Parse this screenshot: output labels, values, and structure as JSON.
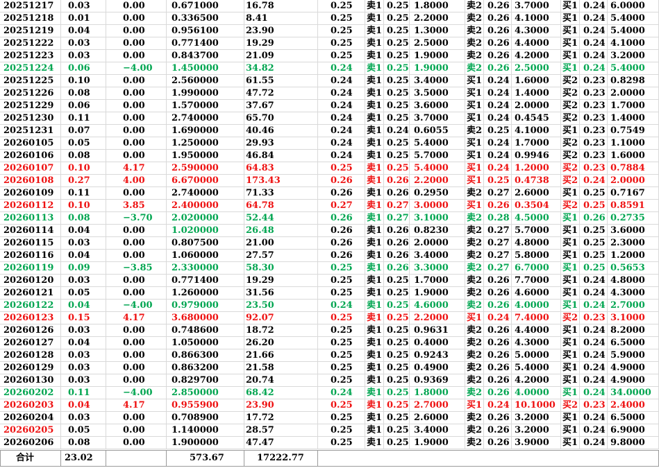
{
  "colors": {
    "normal": "#000000",
    "up": "#ee1111",
    "down": "#00a550"
  },
  "rows": [
    {
      "c": "blk",
      "date": "20251217",
      "rate": "0.03",
      "chg": "0.00",
      "vol": "0.671000",
      "amt": "16.78",
      "price": "0.25",
      "s1": "卖1",
      "s1p": "0.25",
      "s1v": "1.8000",
      "s2": "卖2",
      "s2p": "0.26",
      "s2v": "3.7000",
      "b1": "买1",
      "b1p": "0.24",
      "b1v": "6.0000"
    },
    {
      "c": "blk",
      "date": "20251218",
      "rate": "0.01",
      "chg": "0.00",
      "vol": "0.336500",
      "amt": "8.41",
      "price": "0.25",
      "s1": "卖1",
      "s1p": "0.25",
      "s1v": "2.2000",
      "s2": "卖2",
      "s2p": "0.26",
      "s2v": "4.1000",
      "b1": "买1",
      "b1p": "0.24",
      "b1v": "5.4000"
    },
    {
      "c": "blk",
      "date": "20251219",
      "rate": "0.04",
      "chg": "0.00",
      "vol": "0.956100",
      "amt": "23.90",
      "price": "0.25",
      "s1": "卖1",
      "s1p": "0.25",
      "s1v": "1.3000",
      "s2": "卖2",
      "s2p": "0.26",
      "s2v": "4.3000",
      "b1": "买1",
      "b1p": "0.24",
      "b1v": "5.4000"
    },
    {
      "c": "blk",
      "date": "20251222",
      "rate": "0.03",
      "chg": "0.00",
      "vol": "0.771400",
      "amt": "19.29",
      "price": "0.25",
      "s1": "卖1",
      "s1p": "0.25",
      "s1v": "2.5000",
      "s2": "卖2",
      "s2p": "0.26",
      "s2v": "4.4000",
      "b1": "买1",
      "b1p": "0.24",
      "b1v": "4.1000"
    },
    {
      "c": "blk",
      "date": "20251223",
      "rate": "0.03",
      "chg": "0.00",
      "vol": "0.843700",
      "amt": "21.09",
      "price": "0.25",
      "s1": "卖1",
      "s1p": "0.25",
      "s1v": "1.9000",
      "s2": "卖2",
      "s2p": "0.26",
      "s2v": "4.2000",
      "b1": "买1",
      "b1p": "0.24",
      "b1v": "3.2000"
    },
    {
      "c": "grn",
      "date": "20251224",
      "rate": "0.06",
      "chg": "−4.00",
      "vol": "1.450000",
      "amt": "34.82",
      "price": "0.24",
      "s1": "卖1",
      "s1p": "0.25",
      "s1v": "1.9000",
      "s2": "卖2",
      "s2p": "0.26",
      "s2v": "2.5000",
      "b1": "买1",
      "b1p": "0.24",
      "b1v": "5.4000"
    },
    {
      "c": "blk",
      "date": "20251225",
      "rate": "0.10",
      "chg": "0.00",
      "vol": "2.560000",
      "amt": "61.55",
      "price": "0.24",
      "s1": "卖1",
      "s1p": "0.25",
      "s1v": "3.4000",
      "s2": "买1",
      "s2p": "0.24",
      "s2v": "1.6000",
      "b1": "买2",
      "b1p": "0.23",
      "b1v": "0.8298"
    },
    {
      "c": "blk",
      "date": "20251226",
      "rate": "0.08",
      "chg": "0.00",
      "vol": "1.990000",
      "amt": "47.72",
      "price": "0.24",
      "s1": "卖1",
      "s1p": "0.25",
      "s1v": "3.5000",
      "s2": "买1",
      "s2p": "0.24",
      "s2v": "1.4000",
      "b1": "买2",
      "b1p": "0.23",
      "b1v": "2.0000"
    },
    {
      "c": "blk",
      "date": "20251229",
      "rate": "0.06",
      "chg": "0.00",
      "vol": "1.570000",
      "amt": "37.67",
      "price": "0.24",
      "s1": "卖1",
      "s1p": "0.25",
      "s1v": "3.6000",
      "s2": "买1",
      "s2p": "0.24",
      "s2v": "2.0000",
      "b1": "买2",
      "b1p": "0.23",
      "b1v": "1.7000"
    },
    {
      "c": "blk",
      "date": "20251230",
      "rate": "0.11",
      "chg": "0.00",
      "vol": "2.740000",
      "amt": "65.70",
      "price": "0.24",
      "s1": "卖1",
      "s1p": "0.25",
      "s1v": "3.7000",
      "s2": "买1",
      "s2p": "0.24",
      "s2v": "0.4545",
      "b1": "买2",
      "b1p": "0.23",
      "b1v": "1.4000"
    },
    {
      "c": "blk",
      "date": "20251231",
      "rate": "0.07",
      "chg": "0.00",
      "vol": "1.690000",
      "amt": "40.46",
      "price": "0.24",
      "s1": "卖1",
      "s1p": "0.24",
      "s1v": "0.6055",
      "s2": "卖2",
      "s2p": "0.25",
      "s2v": "4.1000",
      "b1": "买1",
      "b1p": "0.23",
      "b1v": "0.7549"
    },
    {
      "c": "blk",
      "date": "20260105",
      "rate": "0.05",
      "chg": "0.00",
      "vol": "1.250000",
      "amt": "29.93",
      "price": "0.24",
      "s1": "卖1",
      "s1p": "0.25",
      "s1v": "5.4000",
      "s2": "买1",
      "s2p": "0.24",
      "s2v": "1.7000",
      "b1": "买2",
      "b1p": "0.23",
      "b1v": "1.1000"
    },
    {
      "c": "blk",
      "date": "20260106",
      "rate": "0.08",
      "chg": "0.00",
      "vol": "1.950000",
      "amt": "46.84",
      "price": "0.24",
      "s1": "卖1",
      "s1p": "0.25",
      "s1v": "5.7000",
      "s2": "买1",
      "s2p": "0.24",
      "s2v": "0.9946",
      "b1": "买2",
      "b1p": "0.23",
      "b1v": "1.6000"
    },
    {
      "c": "red",
      "date": "20260107",
      "rate": "0.10",
      "chg": "4.17",
      "vol": "2.590000",
      "amt": "64.83",
      "price": "0.25",
      "s1": "卖1",
      "s1p": "0.25",
      "s1v": "5.4000",
      "s2": "买1",
      "s2p": "0.24",
      "s2v": "1.2000",
      "b1": "买2",
      "b1p": "0.23",
      "b1v": "0.7884"
    },
    {
      "c": "red",
      "date": "20260108",
      "rate": "0.27",
      "chg": "4.00",
      "vol": "6.670000",
      "amt": "173.43",
      "price": "0.26",
      "s1": "卖1",
      "s1p": "0.26",
      "s1v": "2.2000",
      "s2": "买1",
      "s2p": "0.25",
      "s2v": "0.4738",
      "b1": "买2",
      "b1p": "0.24",
      "b1v": "2.0000"
    },
    {
      "c": "blk",
      "date": "20260109",
      "rate": "0.11",
      "chg": "0.00",
      "vol": "2.740000",
      "amt": "71.33",
      "price": "0.26",
      "s1": "卖1",
      "s1p": "0.26",
      "s1v": "0.2950",
      "s2": "卖2",
      "s2p": "0.27",
      "s2v": "2.6000",
      "b1": "买1",
      "b1p": "0.25",
      "b1v": "0.7167"
    },
    {
      "c": "red",
      "date": "20260112",
      "rate": "0.10",
      "chg": "3.85",
      "vol": "2.400000",
      "amt": "64.78",
      "price": "0.27",
      "s1": "卖1",
      "s1p": "0.27",
      "s1v": "3.0000",
      "s2": "买1",
      "s2p": "0.26",
      "s2v": "0.3504",
      "b1": "买2",
      "b1p": "0.25",
      "b1v": "0.8591"
    },
    {
      "c": "grn",
      "date": "20260113",
      "rate": "0.08",
      "chg": "−3.70",
      "vol": "2.020000",
      "amt": "52.44",
      "price": "0.26",
      "s1": "卖1",
      "s1p": "0.27",
      "s1v": "3.1000",
      "s2": "卖2",
      "s2p": "0.28",
      "s2v": "4.5000",
      "b1": "买1",
      "b1p": "0.26",
      "b1v": "0.2735"
    },
    {
      "c": "blk",
      "date": "20260114",
      "rate": "0.04",
      "chg": "0.00",
      "vol": "1.020000",
      "amt": "26.48",
      "price": "0.26",
      "s1": "卖1",
      "s1p": "0.26",
      "s1v": "0.8230",
      "s2": "卖2",
      "s2p": "0.27",
      "s2v": "5.7000",
      "b1": "买1",
      "b1p": "0.25",
      "b1v": "3.6000",
      "vc": "grn",
      "ac": "grn"
    },
    {
      "c": "blk",
      "date": "20260115",
      "rate": "0.03",
      "chg": "0.00",
      "vol": "0.807500",
      "amt": "21.00",
      "price": "0.26",
      "s1": "卖1",
      "s1p": "0.26",
      "s1v": "2.0000",
      "s2": "卖2",
      "s2p": "0.27",
      "s2v": "4.8000",
      "b1": "买1",
      "b1p": "0.25",
      "b1v": "2.3000"
    },
    {
      "c": "blk",
      "date": "20260116",
      "rate": "0.04",
      "chg": "0.00",
      "vol": "1.060000",
      "amt": "27.57",
      "price": "0.26",
      "s1": "卖1",
      "s1p": "0.26",
      "s1v": "3.4000",
      "s2": "卖2",
      "s2p": "0.27",
      "s2v": "5.8000",
      "b1": "买1",
      "b1p": "0.25",
      "b1v": "1.2000"
    },
    {
      "c": "grn",
      "date": "20260119",
      "rate": "0.09",
      "chg": "−3.85",
      "vol": "2.330000",
      "amt": "58.30",
      "price": "0.25",
      "s1": "卖1",
      "s1p": "0.26",
      "s1v": "3.3000",
      "s2": "卖2",
      "s2p": "0.27",
      "s2v": "6.7000",
      "b1": "买1",
      "b1p": "0.25",
      "b1v": "0.5653"
    },
    {
      "c": "blk",
      "date": "20260120",
      "rate": "0.03",
      "chg": "0.00",
      "vol": "0.771400",
      "amt": "19.29",
      "price": "0.25",
      "s1": "卖1",
      "s1p": "0.25",
      "s1v": "1.7000",
      "s2": "卖2",
      "s2p": "0.26",
      "s2v": "7.7000",
      "b1": "买1",
      "b1p": "0.24",
      "b1v": "4.8000"
    },
    {
      "c": "blk",
      "date": "20260121",
      "rate": "0.05",
      "chg": "0.00",
      "vol": "1.260000",
      "amt": "31.56",
      "price": "0.25",
      "s1": "卖1",
      "s1p": "0.25",
      "s1v": "1.9000",
      "s2": "卖2",
      "s2p": "0.26",
      "s2v": "4.6000",
      "b1": "买1",
      "b1p": "0.24",
      "b1v": "4.3000"
    },
    {
      "c": "grn",
      "date": "20260122",
      "rate": "0.04",
      "chg": "−4.00",
      "vol": "0.979000",
      "amt": "23.50",
      "price": "0.24",
      "s1": "卖1",
      "s1p": "0.25",
      "s1v": "4.6000",
      "s2": "卖2",
      "s2p": "0.26",
      "s2v": "4.0000",
      "b1": "买1",
      "b1p": "0.24",
      "b1v": "2.7000"
    },
    {
      "c": "red",
      "date": "20260123",
      "rate": "0.15",
      "chg": "4.17",
      "vol": "3.680000",
      "amt": "92.07",
      "price": "0.25",
      "s1": "卖1",
      "s1p": "0.25",
      "s1v": "2.2000",
      "s2": "买1",
      "s2p": "0.24",
      "s2v": "7.4000",
      "b1": "买2",
      "b1p": "0.23",
      "b1v": "3.1000"
    },
    {
      "c": "blk",
      "date": "20260126",
      "rate": "0.03",
      "chg": "0.00",
      "vol": "0.748600",
      "amt": "18.72",
      "price": "0.25",
      "s1": "卖1",
      "s1p": "0.25",
      "s1v": "0.9631",
      "s2": "卖2",
      "s2p": "0.26",
      "s2v": "4.4000",
      "b1": "买1",
      "b1p": "0.24",
      "b1v": "8.2000"
    },
    {
      "c": "blk",
      "date": "20260127",
      "rate": "0.04",
      "chg": "0.00",
      "vol": "1.050000",
      "amt": "26.20",
      "price": "0.25",
      "s1": "卖1",
      "s1p": "0.25",
      "s1v": "0.4000",
      "s2": "卖2",
      "s2p": "0.26",
      "s2v": "4.3000",
      "b1": "买1",
      "b1p": "0.24",
      "b1v": "6.5000"
    },
    {
      "c": "blk",
      "date": "20260128",
      "rate": "0.03",
      "chg": "0.00",
      "vol": "0.866300",
      "amt": "21.66",
      "price": "0.25",
      "s1": "卖1",
      "s1p": "0.25",
      "s1v": "0.9243",
      "s2": "卖2",
      "s2p": "0.26",
      "s2v": "5.0000",
      "b1": "买1",
      "b1p": "0.24",
      "b1v": "5.9000"
    },
    {
      "c": "blk",
      "date": "20260129",
      "rate": "0.03",
      "chg": "0.00",
      "vol": "0.863200",
      "amt": "21.58",
      "price": "0.25",
      "s1": "卖1",
      "s1p": "0.25",
      "s1v": "0.4900",
      "s2": "卖2",
      "s2p": "0.26",
      "s2v": "5.4000",
      "b1": "买1",
      "b1p": "0.24",
      "b1v": "4.9000"
    },
    {
      "c": "blk",
      "date": "20260130",
      "rate": "0.03",
      "chg": "0.00",
      "vol": "0.829700",
      "amt": "20.74",
      "price": "0.25",
      "s1": "卖1",
      "s1p": "0.25",
      "s1v": "0.9369",
      "s2": "卖2",
      "s2p": "0.26",
      "s2v": "4.2000",
      "b1": "买1",
      "b1p": "0.24",
      "b1v": "4.9000"
    },
    {
      "c": "grn",
      "date": "20260202",
      "rate": "0.11",
      "chg": "−4.00",
      "vol": "2.850000",
      "amt": "68.42",
      "price": "0.24",
      "s1": "卖1",
      "s1p": "0.25",
      "s1v": "1.8000",
      "s2": "卖2",
      "s2p": "0.26",
      "s2v": "4.0000",
      "b1": "买1",
      "b1p": "0.24",
      "b1v": "34.0000"
    },
    {
      "c": "red",
      "date": "20260203",
      "rate": "0.04",
      "chg": "4.17",
      "vol": "0.955900",
      "amt": "23.90",
      "price": "0.25",
      "s1": "卖1",
      "s1p": "0.25",
      "s1v": "2.7000",
      "s2": "买1",
      "s2p": "0.24",
      "s2v": "10.1000",
      "b1": "买2",
      "b1p": "0.23",
      "b1v": "2.4000"
    },
    {
      "c": "blk",
      "date": "20260204",
      "rate": "0.03",
      "chg": "0.00",
      "vol": "0.708900",
      "amt": "17.72",
      "price": "0.25",
      "s1": "卖1",
      "s1p": "0.25",
      "s1v": "2.6000",
      "s2": "卖2",
      "s2p": "0.26",
      "s2v": "3.2000",
      "b1": "买1",
      "b1p": "0.24",
      "b1v": "6.5000"
    },
    {
      "c": "blk",
      "date": "20260205",
      "rate": "0.05",
      "chg": "0.00",
      "vol": "1.140000",
      "amt": "28.57",
      "price": "0.25",
      "s1": "卖1",
      "s1p": "0.25",
      "s1v": "3.4000",
      "s2": "卖2",
      "s2p": "0.26",
      "s2v": "3.2000",
      "b1": "买1",
      "b1p": "0.24",
      "b1v": "6.9000",
      "dc": "red"
    },
    {
      "c": "blk",
      "date": "20260206",
      "rate": "0.08",
      "chg": "0.00",
      "vol": "1.900000",
      "amt": "47.47",
      "price": "0.25",
      "s1": "卖1",
      "s1p": "0.25",
      "s1v": "1.9000",
      "s2": "卖2",
      "s2p": "0.26",
      "s2v": "3.9000",
      "b1": "买1",
      "b1p": "0.24",
      "b1v": "9.8000"
    }
  ],
  "totals": {
    "label": "合计",
    "rate": "23.02",
    "vol": "573.67",
    "amt": "17222.77"
  }
}
